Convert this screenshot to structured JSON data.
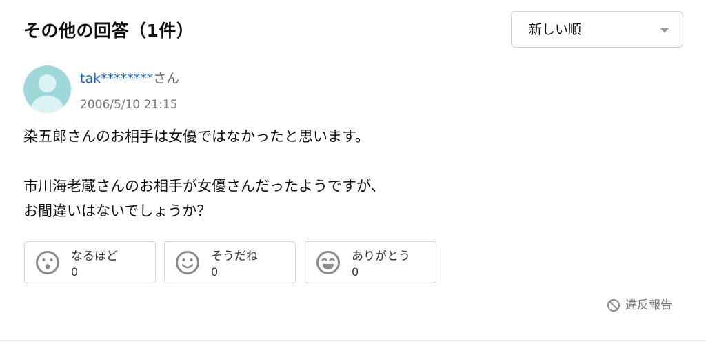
{
  "section": {
    "title": "その他の回答（1件）"
  },
  "sort": {
    "selected": "新しい順"
  },
  "answer": {
    "user_name": "tak********",
    "user_suffix": "さん",
    "date": "2006/5/10 21:15",
    "paragraphs": [
      [
        "染五郎さんのお相手は女優ではなかったと思います。"
      ],
      [
        "市川海老蔵さんのお相手が女優さんだったようですが、",
        "お間違いはないでしょうか？"
      ]
    ]
  },
  "reactions": [
    {
      "label": "なるほど",
      "count": "0",
      "icon": "surprised-face-icon"
    },
    {
      "label": "そうだね",
      "count": "0",
      "icon": "smile-face-icon"
    },
    {
      "label": "ありがとう",
      "count": "0",
      "icon": "grin-face-icon"
    }
  ],
  "report": {
    "label": "違反報告",
    "icon": "prohibited-icon"
  },
  "colors": {
    "link_blue": "#1a60c7",
    "avatar_teal": "#9fd8d8",
    "avatar_light": "#dcf3f3",
    "icon_gray": "#8c8c8c"
  }
}
